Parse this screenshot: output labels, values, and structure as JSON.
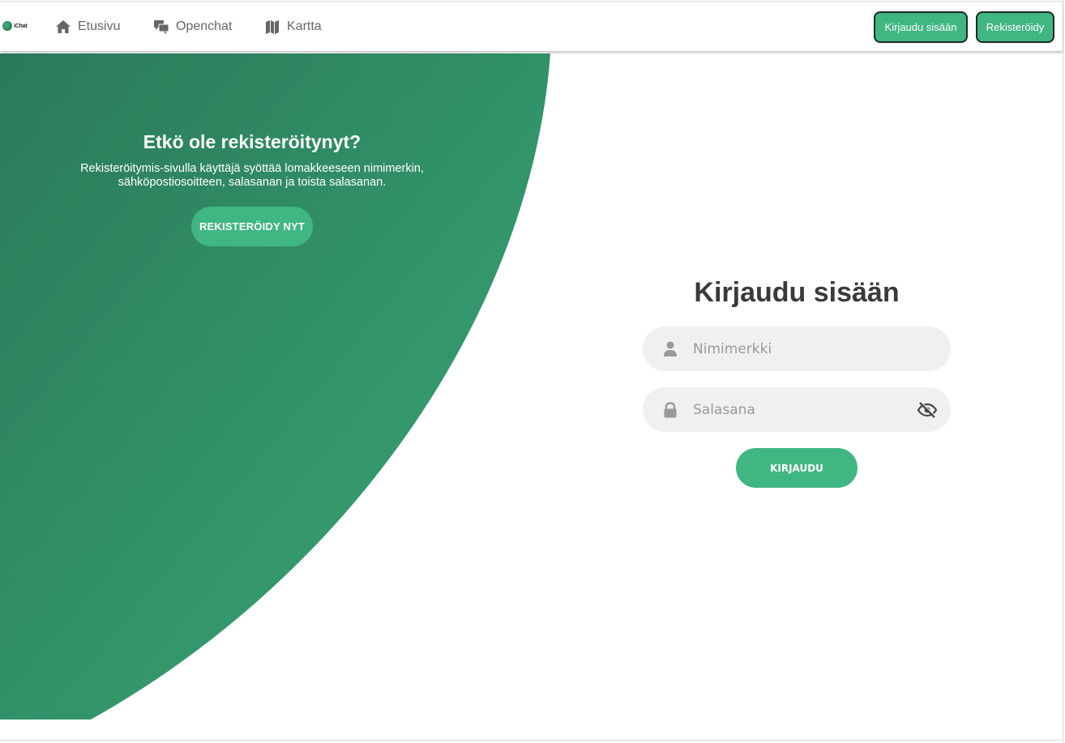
{
  "brand": {
    "logo_text": "iChat",
    "accent": "#40b683",
    "panel_gradient": [
      "#2a7a59",
      "#3aa877"
    ]
  },
  "nav": {
    "links": [
      {
        "label": "Etusivu",
        "icon": "home-icon"
      },
      {
        "label": "Openchat",
        "icon": "chat-bubbles-icon"
      },
      {
        "label": "Kartta",
        "icon": "map-icon"
      }
    ],
    "login_button": "Kirjaudu sisään",
    "register_button": "Rekisteröidy"
  },
  "promo": {
    "title": "Etkö ole rekisteröitynyt?",
    "text_line1": "Rekisteröitymis-sivulla käyttäjä syöttää lomakkeeseen nimimerkin,",
    "text_line2": "sähköpostiosoitteen, salasanan ja toista salasanan.",
    "button": "REKISTERÖIDY NYT"
  },
  "login": {
    "title": "Kirjaudu sisään",
    "username_placeholder": "Nimimerkki",
    "username_icon": "user-icon",
    "password_placeholder": "Salasana",
    "password_icon": "lock-icon",
    "toggle_icon": "eye-slash-icon",
    "submit": "KIRJAUDU"
  }
}
